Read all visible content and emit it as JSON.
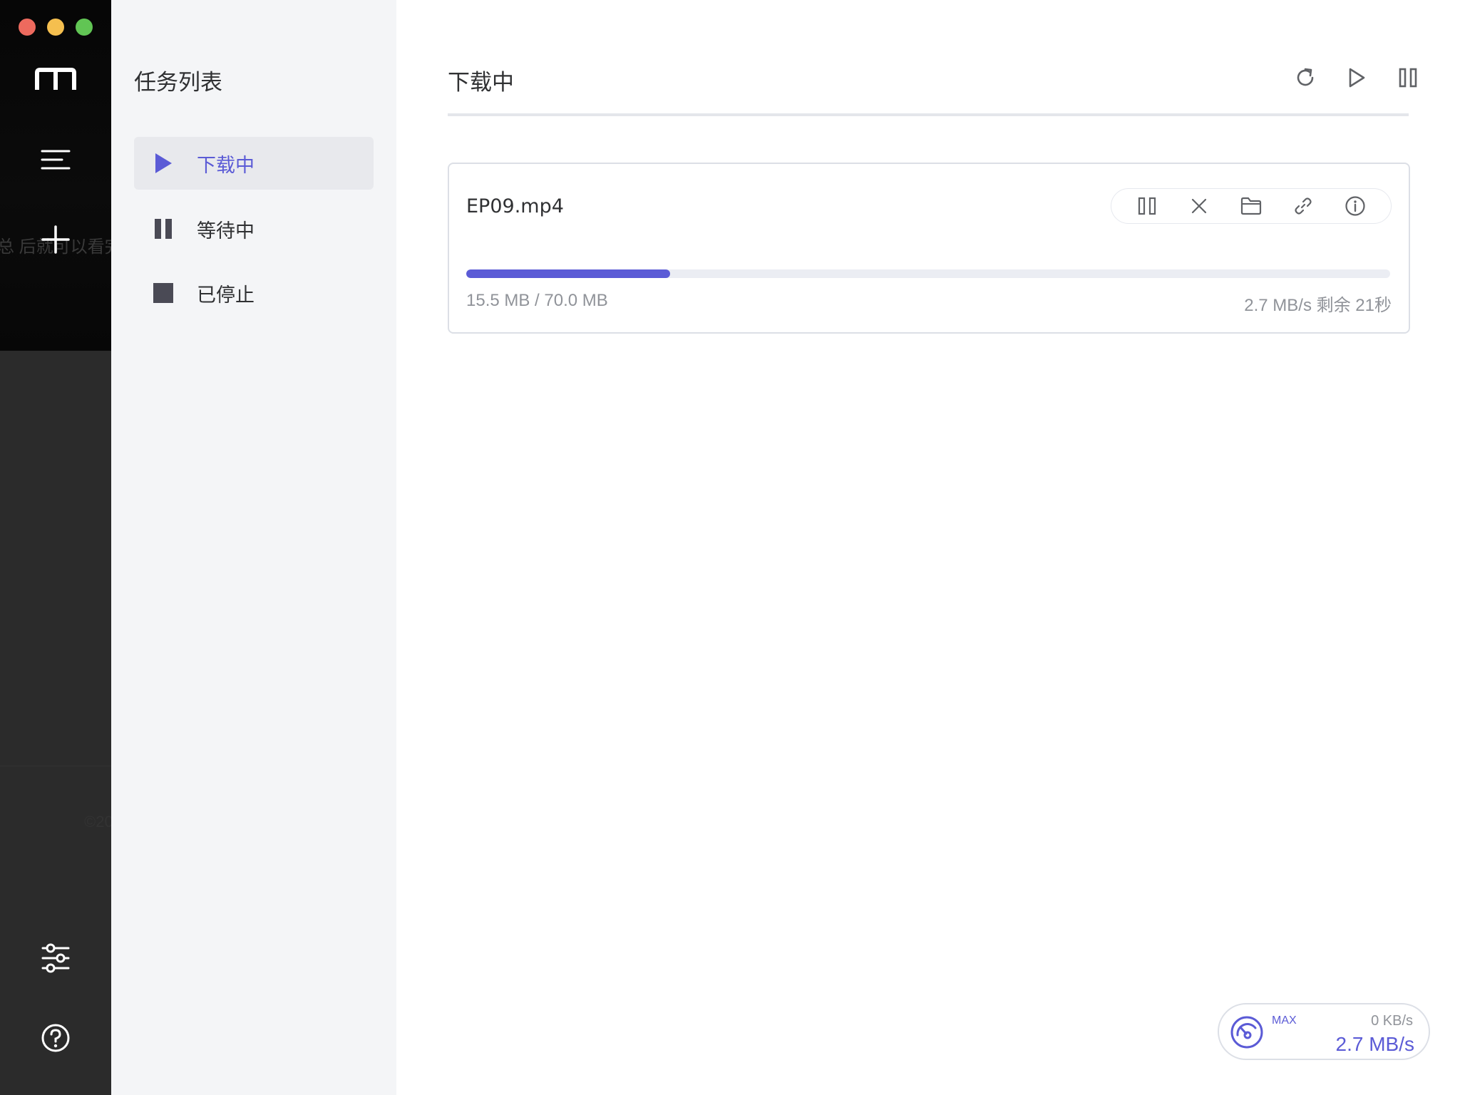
{
  "rail": {
    "ghost_text": "总 后就可以看完",
    "ghost_text2": "©20",
    "icons": [
      "logo-icon",
      "menu-icon",
      "add-icon",
      "settings-icon",
      "help-icon"
    ]
  },
  "sidebar": {
    "title": "任务列表",
    "items": [
      {
        "label": "下载中",
        "icon": "play-icon",
        "active": true
      },
      {
        "label": "等待中",
        "icon": "pause-icon",
        "active": false
      },
      {
        "label": "已停止",
        "icon": "stop-icon",
        "active": false
      }
    ]
  },
  "main": {
    "title": "下载中",
    "toolbar": [
      "refresh-icon",
      "resume-all-icon",
      "pause-all-icon"
    ]
  },
  "task": {
    "name": "EP09.mp4",
    "progress": 0.221,
    "size_text": "15.5 MB / 70.0 MB",
    "speed_text": "2.7 MB/s 剩余 21秒",
    "actions": [
      "pause-icon",
      "delete-icon",
      "folder-icon",
      "link-icon",
      "info-icon"
    ]
  },
  "speed": {
    "max_label": "MAX",
    "upload": "0 KB/s",
    "download": "2.7 MB/s"
  },
  "colors": {
    "accent": "#5b5bd6",
    "rail_bg": "#2b2b2b",
    "sidebar_bg": "#f4f5f7",
    "active_bg": "#e8e9ed"
  }
}
